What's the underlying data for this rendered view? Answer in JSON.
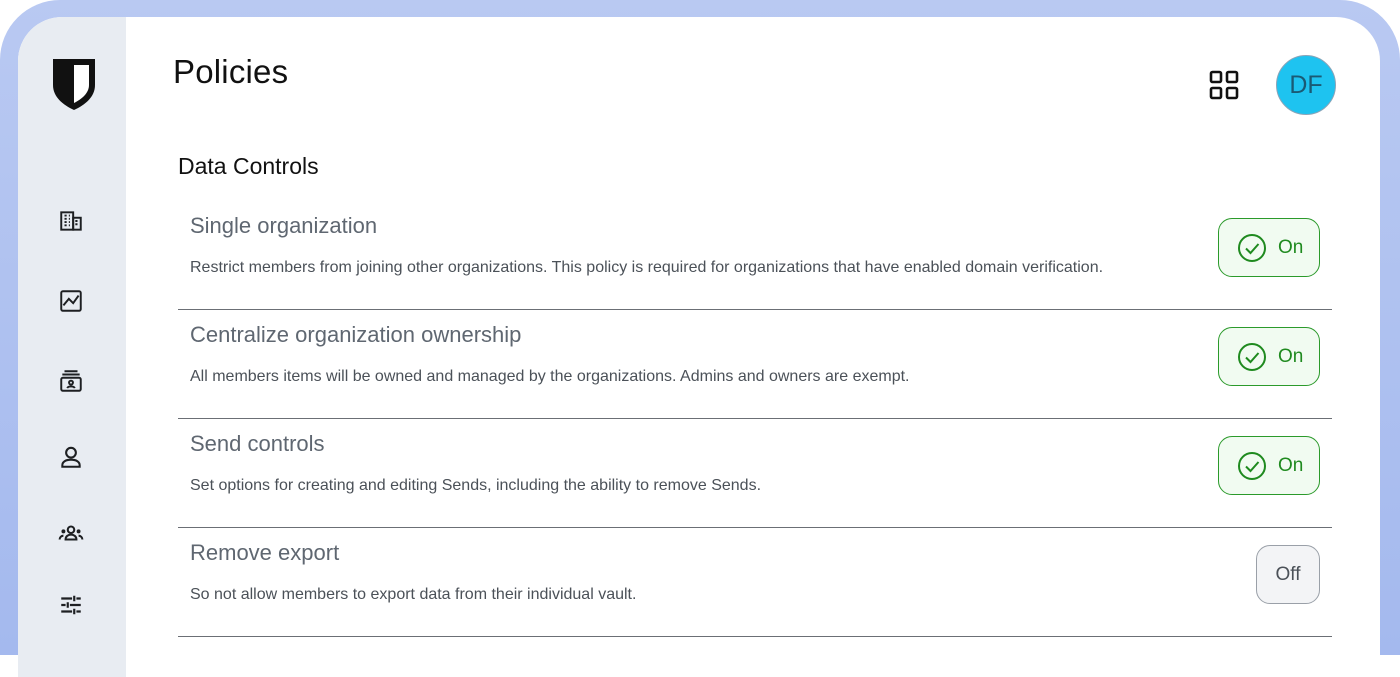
{
  "header": {
    "title": "Policies",
    "apps_icon": "grid-icon",
    "avatar_initials": "DF",
    "avatar_color": "#1ec3f0"
  },
  "sidebar": {
    "logo_icon": "shield-logo-icon",
    "items": [
      {
        "icon": "building-icon"
      },
      {
        "icon": "reports-icon"
      },
      {
        "icon": "billing-icon"
      },
      {
        "icon": "person-icon"
      },
      {
        "icon": "groups-icon"
      },
      {
        "icon": "sliders-icon"
      }
    ]
  },
  "section": {
    "title": "Data Controls"
  },
  "policies": [
    {
      "name": "Single organization",
      "description": "Restrict members from joining other organizations. This policy is required for organizations that have enabled domain verification.",
      "status": "On"
    },
    {
      "name": "Centralize organization ownership",
      "description": "All members items will be owned and managed by the organizations. Admins and owners are exempt.",
      "status": "On"
    },
    {
      "name": "Send controls",
      "description": "Set options for creating and editing Sends, including the ability to remove Sends.",
      "status": "On"
    },
    {
      "name": "Remove export",
      "description": "So not allow members to export data from their individual vault.",
      "status": "Off"
    }
  ],
  "colors": {
    "on_green": "#1f8a1f",
    "sidebar_bg": "#e8ecf2",
    "frame_gradient": "#b9c9f2"
  }
}
